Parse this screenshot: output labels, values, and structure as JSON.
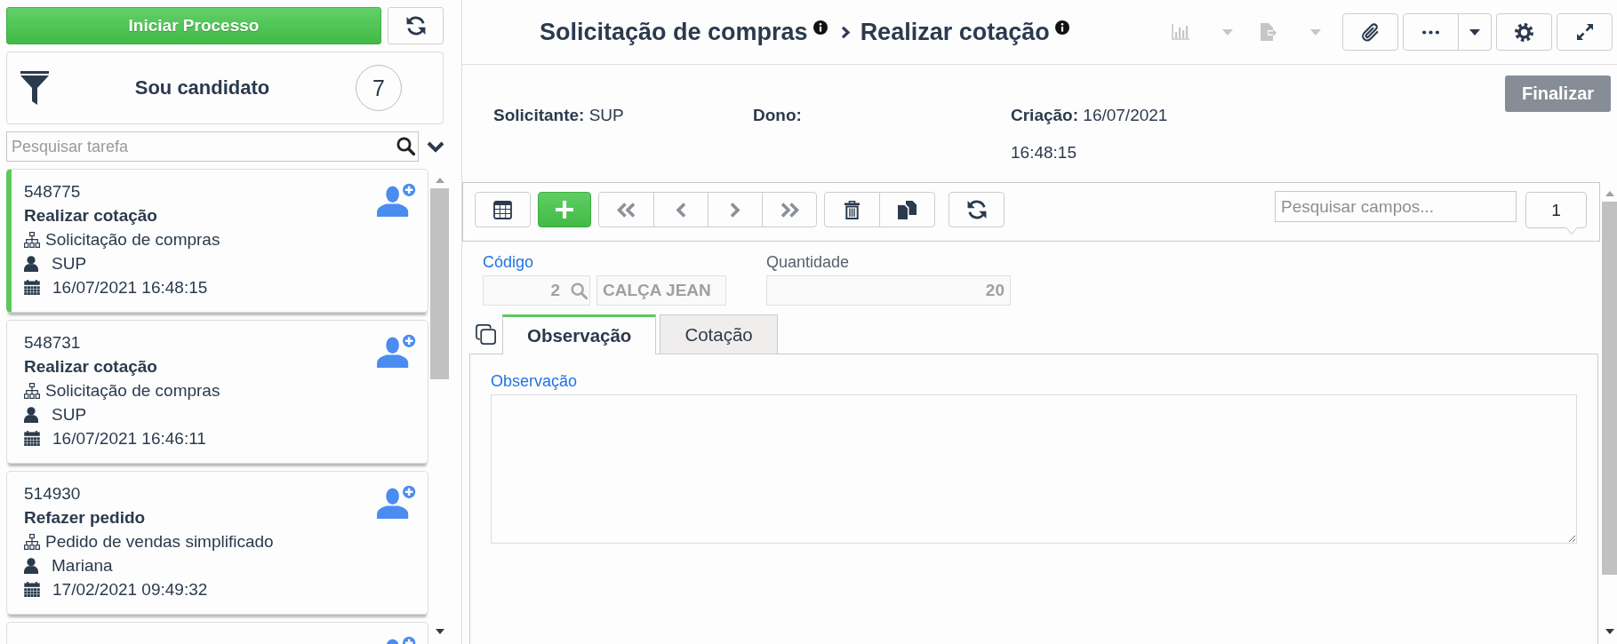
{
  "sidebar": {
    "start_button": "Iniciar Processo",
    "filter": {
      "label": "Sou candidato",
      "count": "7"
    },
    "search": {
      "placeholder": "Pesquisar tarefa"
    },
    "tasks": [
      {
        "kind": "full",
        "selected": true,
        "id": "548775",
        "title": "Realizar cotação",
        "process": "Solicitação de compras",
        "user": "SUP",
        "date": "16/07/2021 16:48:15"
      },
      {
        "kind": "full",
        "selected": false,
        "id": "548731",
        "title": "Realizar cotação",
        "process": "Solicitação de compras",
        "user": "SUP",
        "date": "16/07/2021 16:46:11"
      },
      {
        "kind": "full",
        "selected": false,
        "id": "514930",
        "title": "Refazer pedido",
        "process": "Pedido de vendas simplificado",
        "user": "Mariana",
        "date": "17/02/2021 09:49:32"
      },
      {
        "kind": "clipped",
        "selected": false
      }
    ]
  },
  "header": {
    "breadcrumb": [
      "Solicitação de compras",
      "Realizar cotação"
    ],
    "tools": [
      {
        "kind": "chart",
        "disabled": true,
        "dropdown": true
      },
      {
        "kind": "export",
        "disabled": true,
        "dropdown": true
      },
      {
        "kind": "attach",
        "disabled": false,
        "dropdown": false
      },
      {
        "kind": "more",
        "disabled": false,
        "dropdown": true
      },
      {
        "kind": "settings",
        "disabled": false,
        "dropdown": false
      },
      {
        "kind": "expand",
        "disabled": false,
        "dropdown": false
      }
    ],
    "info": [
      {
        "label": "Solicitante:",
        "value": "SUP"
      },
      {
        "label": "Dono:"
      },
      {
        "label": "Criação:",
        "value": "16/07/2021 16:48:15"
      }
    ],
    "finish_button": "Finalizar"
  },
  "form": {
    "toolbar": [
      {
        "buttons": [
          {
            "kind": "grid"
          }
        ]
      },
      {
        "buttons": [
          {
            "kind": "add"
          }
        ]
      },
      {
        "buttons": [
          {
            "kind": "first"
          },
          {
            "kind": "previous"
          },
          {
            "kind": "next"
          },
          {
            "kind": "last"
          }
        ]
      },
      {
        "buttons": [
          {
            "kind": "delete"
          },
          {
            "kind": "duplicate"
          }
        ]
      },
      {
        "buttons": [
          {
            "kind": "refresh"
          }
        ]
      }
    ],
    "field_search": {
      "placeholder": "Pesquisar campos..."
    },
    "record_badge": "1",
    "fields": [
      {
        "label": "Código",
        "highlighted": true,
        "inputs": [
          {
            "kind": "lookup",
            "value": "2",
            "disabled": true
          },
          {
            "kind": "text",
            "value": "CALÇA JEAN",
            "disabled": true
          }
        ]
      },
      {
        "label": "Quantidade",
        "highlighted": false,
        "inputs": [
          {
            "kind": "number",
            "value": "20",
            "disabled": true
          }
        ]
      }
    ],
    "tabs": [
      {
        "label": "Observação",
        "selected": true
      },
      {
        "label": "Cotação",
        "selected": false
      }
    ],
    "tab_fields": [
      {
        "label": "Observação",
        "highlighted": true,
        "kind": "textarea"
      }
    ]
  }
}
